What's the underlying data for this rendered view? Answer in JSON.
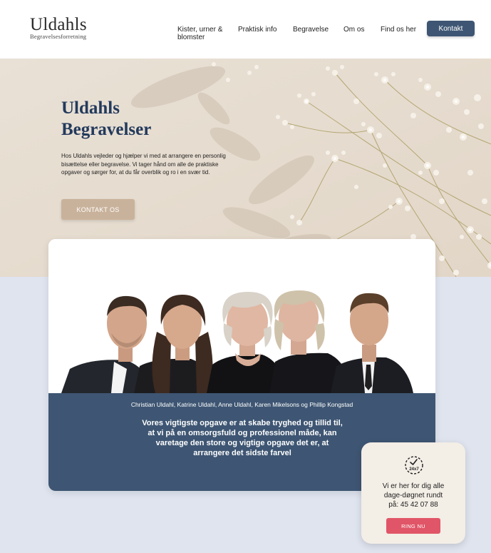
{
  "header": {
    "logo_title": "Uldahls",
    "logo_subtitle": "Begravelsesforretning",
    "nav": [
      {
        "line1": "Kister, urner &",
        "line2": "blomster"
      },
      {
        "line1": "Praktisk info",
        "line2": ""
      },
      {
        "line1": "Begravelse",
        "line2": ""
      },
      {
        "line1": "Om os",
        "line2": ""
      },
      {
        "line1": "Find os her",
        "line2": ""
      }
    ],
    "contact_label": "Kontakt"
  },
  "hero": {
    "title_line1": "Uldahls",
    "title_line2": "Begravelser",
    "text": "Hos Uldahls vejleder og hjælper vi med at arrangere en personlig bisættelse eller begravelse. Vi tager hånd om alle de praktiske opgaver og sørger for, at du får overblik og ro i en svær tid.",
    "button_label": "KONTAKT OS"
  },
  "team": {
    "names": "Christian Uldahl, Katrine Uldahl, Anne Uldahl, Karen Mikelsons og Phillip Kongstad",
    "quote": "Vores vigtigste opgave er at skabe tryghed og tillid til, at vi på en omsorgsfuld og professionel måde, kan varetage den store og vigtige opgave det er, at arrangere det sidste farvel"
  },
  "call": {
    "clock_label": "24x7",
    "text_line1": "Vi er her for dig alle",
    "text_line2": "dage-døgnet rundt",
    "text_line3": "på: 45 42 07 88",
    "button_label": "RING NU"
  },
  "colors": {
    "navy": "#3e5673",
    "title_navy": "#233a5c",
    "beige": "#e7ddd1",
    "button_tan": "#c9b29b",
    "ring_red": "#e05567",
    "page_blue": "#dfe4ef"
  },
  "icons": {
    "clock": "clock-24x7-icon"
  }
}
